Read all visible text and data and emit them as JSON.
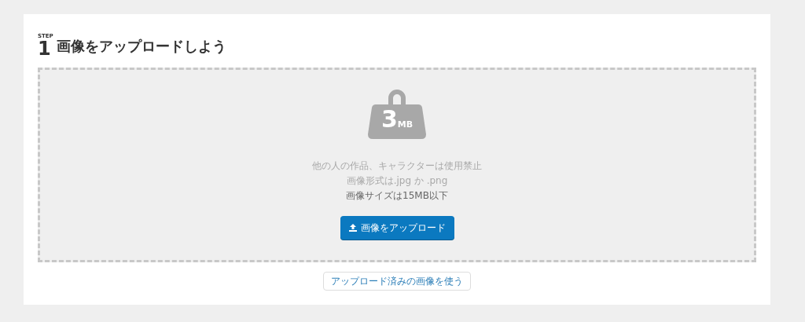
{
  "heading": {
    "step_label": "STEP",
    "step_number": "1",
    "title": "画像をアップロードしよう"
  },
  "dropzone": {
    "size_badge": {
      "number": "3",
      "unit": "MB"
    },
    "notes": [
      {
        "text": "他の人の作品、キャラクターは使用禁止",
        "emphasis": false
      },
      {
        "text": "画像形式は.jpg か .png",
        "emphasis": false
      },
      {
        "text": "画像サイズは15MB以下",
        "emphasis": true
      }
    ],
    "upload_button": "画像をアップロード"
  },
  "secondary_button": "アップロード済みの画像を使う"
}
